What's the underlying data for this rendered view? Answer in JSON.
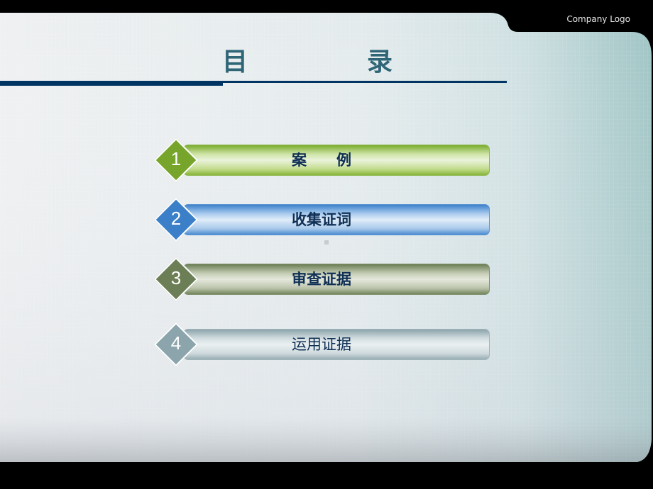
{
  "header": {
    "company_logo": "Company Logo",
    "title_chars": [
      "目",
      "录"
    ]
  },
  "menu": {
    "items": [
      {
        "number": "1",
        "label": "案　　例",
        "color": "#77a52c",
        "bold": true
      },
      {
        "number": "2",
        "label": "收集证词",
        "color": "#3a7fc8",
        "bold": true
      },
      {
        "number": "3",
        "label": "审查证据",
        "color": "#6c7e55",
        "bold": true
      },
      {
        "number": "4",
        "label": "运用证据",
        "color": "#8ca4ac",
        "bold": false
      }
    ]
  },
  "colors": {
    "title": "#2e6577",
    "rule": "#003463",
    "label_text": "#0f2f55",
    "frame": "#000000"
  }
}
